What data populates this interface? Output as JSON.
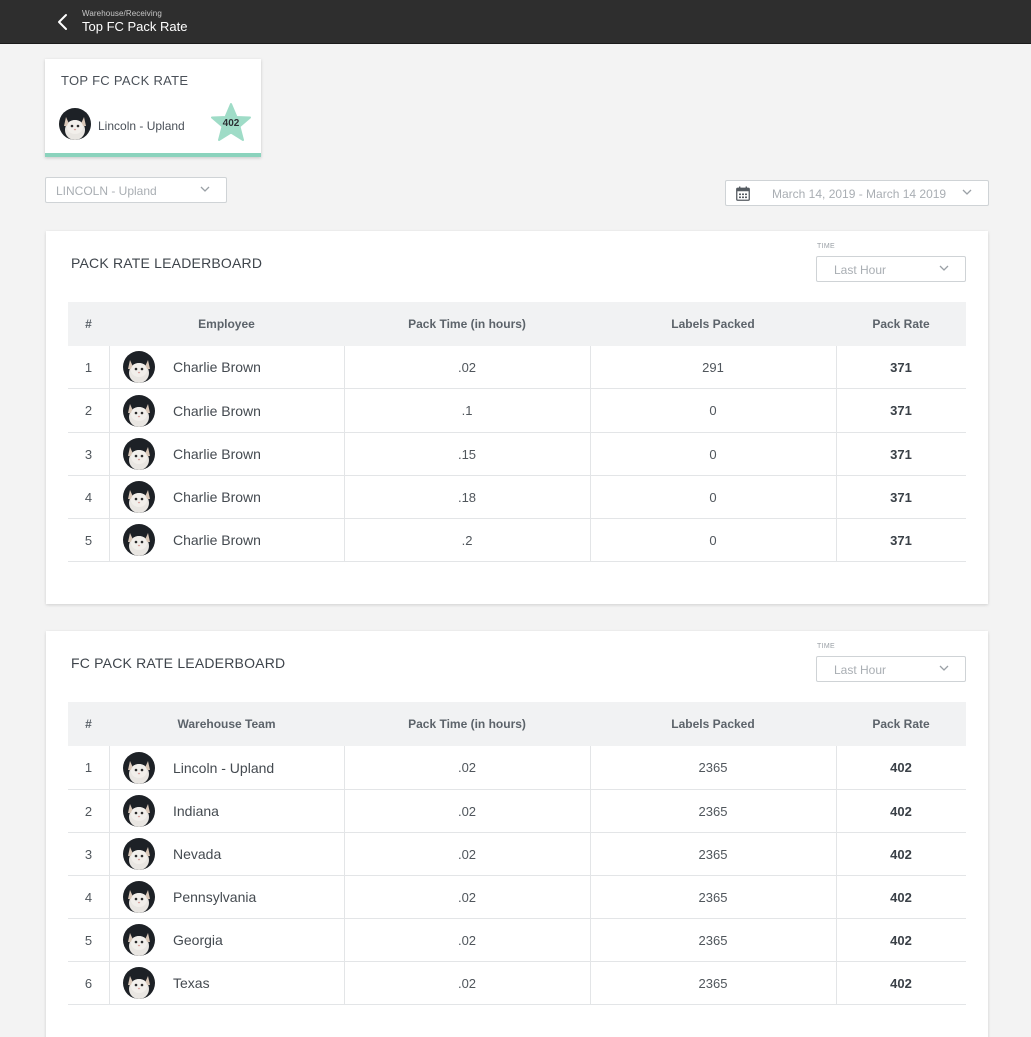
{
  "header": {
    "breadcrumb": "Warehouse/Receiving",
    "title": "Top FC Pack Rate",
    "back_icon": "chevron-left-icon"
  },
  "top_card": {
    "title": "TOP FC PACK RATE",
    "name": "Lincoln - Upland",
    "score": "402",
    "accent_color": "#8bd3bd"
  },
  "filters": {
    "location": "LINCOLN - Upland",
    "date_range": "March 14, 2019 - March 14 2019"
  },
  "pack_leaderboard": {
    "title": "PACK RATE LEADERBOARD",
    "time_label": "TIME",
    "time_value": "Last Hour",
    "columns": [
      "#",
      "Employee",
      "Pack Time (in hours)",
      "Labels Packed",
      "Pack Rate"
    ],
    "rows": [
      {
        "rank": "1",
        "name": "Charlie Brown",
        "pack_time": ".02",
        "labels": "291",
        "rate": "371"
      },
      {
        "rank": "2",
        "name": "Charlie Brown",
        "pack_time": ".1",
        "labels": "0",
        "rate": "371"
      },
      {
        "rank": "3",
        "name": "Charlie Brown",
        "pack_time": ".15",
        "labels": "0",
        "rate": "371"
      },
      {
        "rank": "4",
        "name": "Charlie Brown",
        "pack_time": ".18",
        "labels": "0",
        "rate": "371"
      },
      {
        "rank": "5",
        "name": "Charlie Brown",
        "pack_time": ".2",
        "labels": "0",
        "rate": "371"
      }
    ]
  },
  "fc_leaderboard": {
    "title": "FC PACK RATE LEADERBOARD",
    "time_label": "TIME",
    "time_value": "Last Hour",
    "columns": [
      "#",
      "Warehouse Team",
      "Pack Time (in hours)",
      "Labels Packed",
      "Pack Rate"
    ],
    "rows": [
      {
        "rank": "1",
        "name": "Lincoln - Upland",
        "pack_time": ".02",
        "labels": "2365",
        "rate": "402"
      },
      {
        "rank": "2",
        "name": "Indiana",
        "pack_time": ".02",
        "labels": "2365",
        "rate": "402"
      },
      {
        "rank": "3",
        "name": "Nevada",
        "pack_time": ".02",
        "labels": "2365",
        "rate": "402"
      },
      {
        "rank": "4",
        "name": "Pennsylvania",
        "pack_time": ".02",
        "labels": "2365",
        "rate": "402"
      },
      {
        "rank": "5",
        "name": "Georgia",
        "pack_time": ".02",
        "labels": "2365",
        "rate": "402"
      },
      {
        "rank": "6",
        "name": "Texas",
        "pack_time": ".02",
        "labels": "2365",
        "rate": "402"
      }
    ]
  }
}
